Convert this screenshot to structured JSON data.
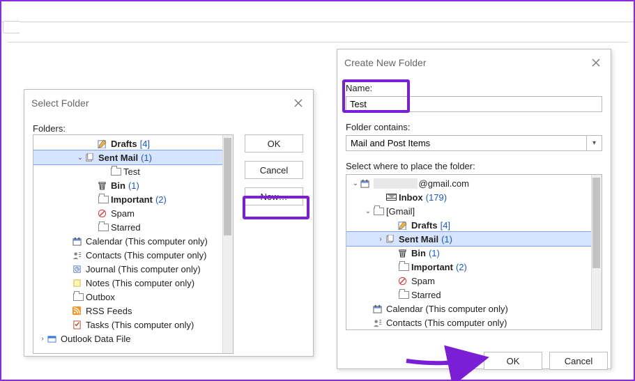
{
  "select_dialog": {
    "title": "Select Folder",
    "folders_label": "Folders:",
    "buttons": {
      "ok": "OK",
      "cancel": "Cancel",
      "new": "New…"
    },
    "tree": [
      {
        "indent": 4,
        "icon": "pencil",
        "label": "Drafts",
        "bold": true,
        "count": "[4]"
      },
      {
        "indent": 3,
        "exp": "down",
        "icon": "pages",
        "label": "Sent Mail",
        "bold": true,
        "count": "(1)",
        "selected": true
      },
      {
        "indent": 5,
        "icon": "folder",
        "label": "Test"
      },
      {
        "indent": 4,
        "icon": "trash",
        "label": "Bin",
        "bold": true,
        "count": "(1)"
      },
      {
        "indent": 4,
        "icon": "folder",
        "label": "Important",
        "bold": true,
        "count": "(2)"
      },
      {
        "indent": 4,
        "icon": "block",
        "label": "Spam"
      },
      {
        "indent": 4,
        "icon": "folder",
        "label": "Starred"
      },
      {
        "indent": 2,
        "icon": "calendar",
        "label": "Calendar (This computer only)"
      },
      {
        "indent": 2,
        "icon": "contacts",
        "label": "Contacts (This computer only)"
      },
      {
        "indent": 2,
        "icon": "journal",
        "label": "Journal (This computer only)"
      },
      {
        "indent": 2,
        "icon": "notes",
        "label": "Notes (This computer only)"
      },
      {
        "indent": 2,
        "icon": "folder",
        "label": "Outbox"
      },
      {
        "indent": 2,
        "icon": "rss",
        "label": "RSS Feeds"
      },
      {
        "indent": 2,
        "icon": "tasks",
        "label": "Tasks (This computer only)"
      },
      {
        "indent": 0,
        "exp": "right",
        "icon": "datafile",
        "label": "Outlook Data File"
      }
    ]
  },
  "create_dialog": {
    "title": "Create New Folder",
    "name_label": "Name:",
    "name_value": "Test",
    "contains_label": "Folder contains:",
    "contains_value": "Mail and Post Items",
    "where_label": "Select where to place the folder:",
    "account_suffix": "@gmail.com",
    "buttons": {
      "ok": "OK",
      "cancel": "Cancel"
    },
    "tree": [
      {
        "indent": 0,
        "exp": "down",
        "icon": "calendar",
        "label": "",
        "label_suffix": "@gmail.com"
      },
      {
        "indent": 2,
        "icon": "inbox",
        "label": "Inbox",
        "bold": true,
        "count": "(179)"
      },
      {
        "indent": 1,
        "exp": "down",
        "icon": "folder",
        "label": "[Gmail]"
      },
      {
        "indent": 3,
        "icon": "pencil",
        "label": "Drafts",
        "bold": true,
        "count": "[4]"
      },
      {
        "indent": 2,
        "exp": "right",
        "icon": "pages",
        "label": "Sent Mail",
        "bold": true,
        "count": "(1)",
        "selected": true
      },
      {
        "indent": 3,
        "icon": "trash",
        "label": "Bin",
        "bold": true,
        "count": "(1)"
      },
      {
        "indent": 3,
        "icon": "folder",
        "label": "Important",
        "bold": true,
        "count": "(2)"
      },
      {
        "indent": 3,
        "icon": "block",
        "label": "Spam"
      },
      {
        "indent": 3,
        "icon": "folder",
        "label": "Starred"
      },
      {
        "indent": 1,
        "icon": "calendar",
        "label": "Calendar (This computer only)"
      },
      {
        "indent": 1,
        "icon": "contacts",
        "label": "Contacts (This computer only)"
      }
    ]
  }
}
